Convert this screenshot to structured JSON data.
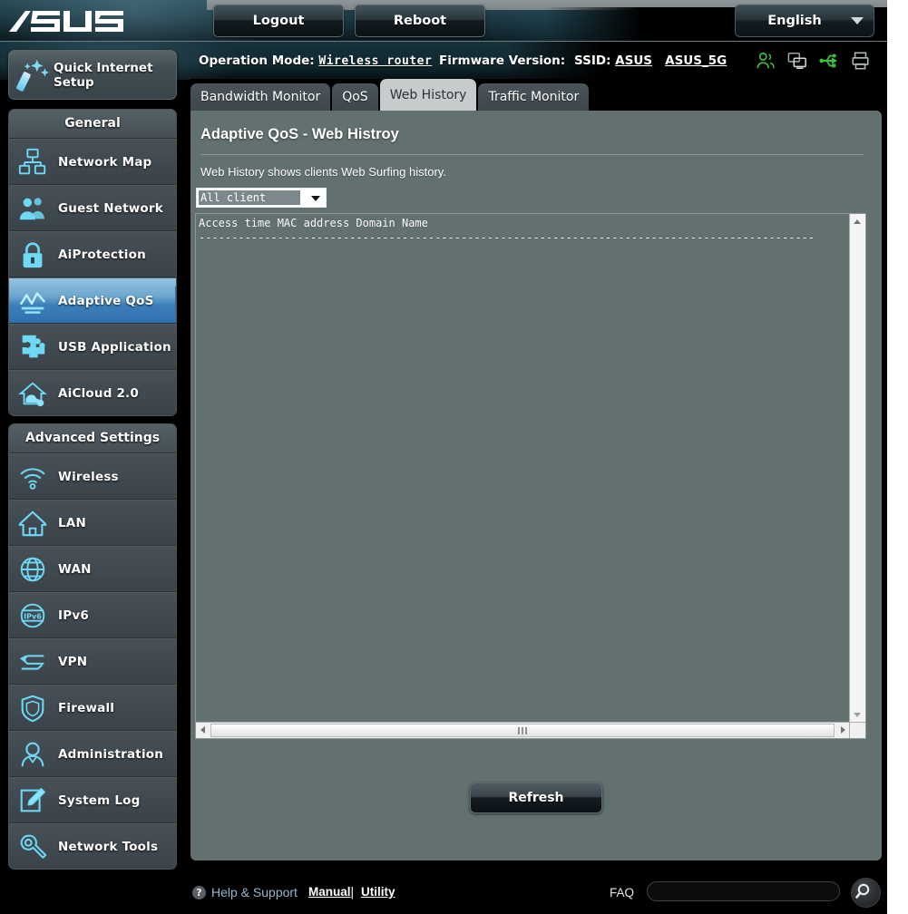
{
  "brand": {
    "logo_text": "/ISUS"
  },
  "topbar": {
    "logout_label": "Logout",
    "reboot_label": "Reboot",
    "language_label": "English",
    "language_caret_icon": "chevron-down-icon"
  },
  "statusbar": {
    "operation_mode_label": "Operation Mode:",
    "operation_mode_value": "Wireless router",
    "firmware_label": "Firmware Version:",
    "firmware_value": "",
    "ssid_label": "SSID:",
    "ssid_1": "ASUS",
    "ssid_2": "ASUS_5G",
    "icons": [
      "clients-icon",
      "screen-share-icon",
      "usb-icon",
      "printer-icon"
    ]
  },
  "sidebar": {
    "quick_setup": {
      "label": "Quick Internet Setup",
      "icon": "magic-wand-icon"
    },
    "general": {
      "title": "General",
      "items": [
        {
          "label": "Network Map",
          "icon": "network-map-icon",
          "active": false
        },
        {
          "label": "Guest Network",
          "icon": "guest-network-icon",
          "active": false
        },
        {
          "label": "AiProtection",
          "icon": "lock-shield-icon",
          "active": false
        },
        {
          "label": "Adaptive QoS",
          "icon": "qos-waveform-icon",
          "active": true
        },
        {
          "label": "USB Application",
          "icon": "puzzle-piece-icon",
          "active": false
        },
        {
          "label": "AiCloud 2.0",
          "icon": "cloud-house-icon",
          "active": false
        }
      ]
    },
    "advanced": {
      "title": "Advanced Settings",
      "items": [
        {
          "label": "Wireless",
          "icon": "wifi-icon",
          "active": false
        },
        {
          "label": "LAN",
          "icon": "house-icon",
          "active": false
        },
        {
          "label": "WAN",
          "icon": "globe-icon",
          "active": false
        },
        {
          "label": "IPv6",
          "icon": "ipv6-globe-icon",
          "active": false
        },
        {
          "label": "VPN",
          "icon": "vpn-arrows-icon",
          "active": false
        },
        {
          "label": "Firewall",
          "icon": "shield-icon",
          "active": false
        },
        {
          "label": "Administration",
          "icon": "user-icon",
          "active": false
        },
        {
          "label": "System Log",
          "icon": "pencil-note-icon",
          "active": false
        },
        {
          "label": "Network Tools",
          "icon": "wrench-icon",
          "active": false
        }
      ]
    }
  },
  "tabs": [
    {
      "label": "Bandwidth Monitor",
      "active": false
    },
    {
      "label": "QoS",
      "active": false
    },
    {
      "label": "Web History",
      "active": true
    },
    {
      "label": "Traffic Monitor",
      "active": false
    }
  ],
  "main": {
    "title": "Adaptive QoS - Web Histroy",
    "description": "Web History shows clients Web Surfing history.",
    "client_filter": {
      "value": "All client",
      "caret_icon": "chevron-down-icon"
    },
    "history": {
      "header_line": "Access time MAC address Domain Name",
      "separator_line": "----------------------------------------------------------------------------------------------",
      "rows": [],
      "content": "Access time MAC address Domain Name\n----------------------------------------------------------------------------------------------"
    },
    "refresh_label": "Refresh",
    "scroll": {
      "vertical_up_icon": "triangle-up-icon",
      "vertical_down_icon": "triangle-down-icon",
      "horizontal_left_icon": "triangle-left-icon",
      "horizontal_right_icon": "triangle-right-icon"
    }
  },
  "footer": {
    "help_icon": "question-mark-icon",
    "help_label": "Help & Support",
    "manual_label": "Manual",
    "separator": "|",
    "utility_label": "Utility",
    "faq_label": "FAQ",
    "faq_value": "",
    "faq_placeholder": "",
    "search_icon": "search-icon"
  },
  "colors": {
    "accent_blue": "#3d7fba",
    "panel_bg": "#62706f",
    "sidebar_bg": "#3d464c",
    "icon_cyan": "#6fd8f5",
    "status_green": "#3bc03b"
  }
}
